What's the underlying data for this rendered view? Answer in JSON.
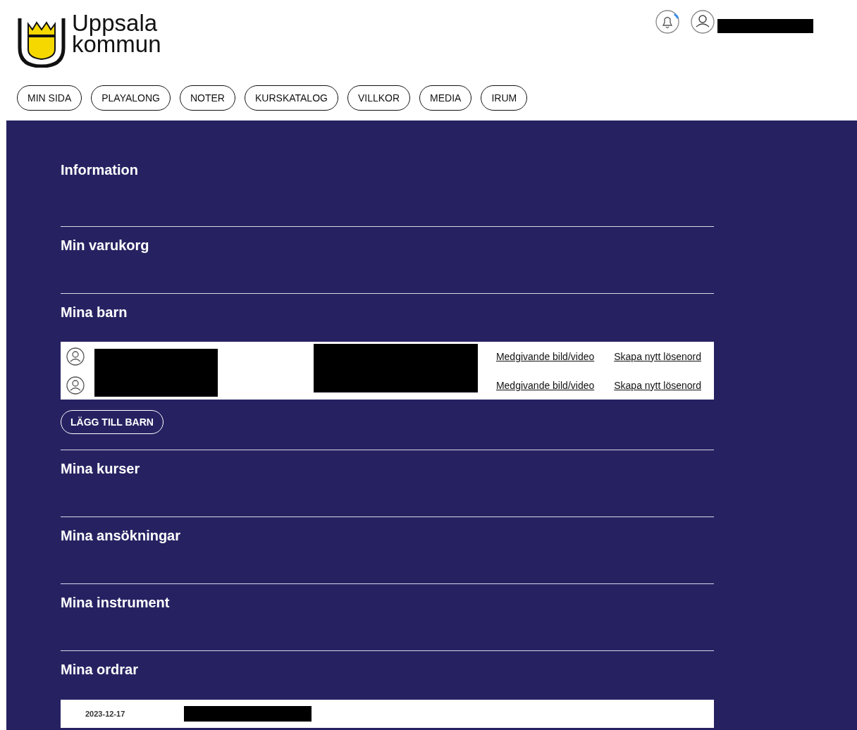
{
  "header": {
    "logo_text": [
      "Uppsala",
      "kommun"
    ]
  },
  "nav": [
    "MIN SIDA",
    "PLAYALONG",
    "NOTER",
    "KURSKATALOG",
    "VILLKOR",
    "MEDIA",
    "IRUM"
  ],
  "sections": [
    {
      "title": "Information",
      "kind": "plain"
    },
    {
      "title": "Min varukorg",
      "kind": "plain"
    },
    {
      "title": "Mina barn",
      "kind": "children",
      "rows": [
        {
          "links": [
            "Medgivande bild/video",
            "Skapa nytt lösenord"
          ]
        },
        {
          "links": [
            "Medgivande bild/video",
            "Skapa nytt lösenord"
          ]
        }
      ],
      "button": "LÄGG TILL BARN"
    },
    {
      "title": "Mina kurser",
      "kind": "plain"
    },
    {
      "title": "Mina ansökningar",
      "kind": "plain"
    },
    {
      "title": "Mina instrument",
      "kind": "plain"
    },
    {
      "title": "Mina ordrar",
      "kind": "orders",
      "rows": [
        {
          "date": "2023-12-17"
        }
      ]
    }
  ]
}
